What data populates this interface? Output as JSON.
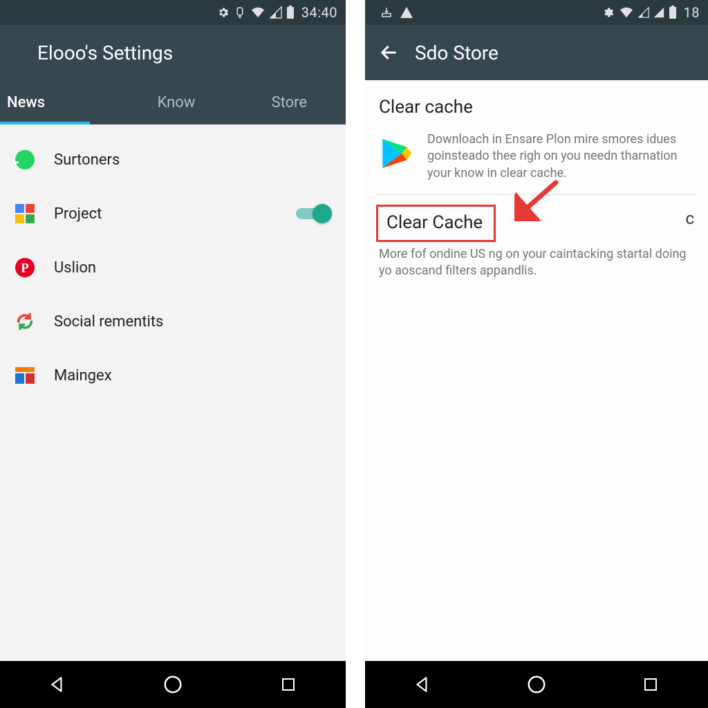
{
  "left": {
    "status": {
      "clock": "34:40"
    },
    "appbar": {
      "title": "Elooo's Settings"
    },
    "tabs": [
      {
        "label": "News",
        "active": true
      },
      {
        "label": "Know",
        "active": false
      },
      {
        "label": "Store",
        "active": false
      }
    ],
    "items": [
      {
        "icon": "whatsapp-icon",
        "label": "Surtoners",
        "toggle": null
      },
      {
        "icon": "google-icon",
        "label": "Project",
        "toggle": true
      },
      {
        "icon": "pinterest-icon",
        "label": "Uslion",
        "toggle": null
      },
      {
        "icon": "refresh-icon",
        "label": "Social rementits",
        "toggle": null
      },
      {
        "icon": "layout-icon",
        "label": "Maingex",
        "toggle": null
      }
    ]
  },
  "right": {
    "status": {
      "clock": "18"
    },
    "appbar": {
      "title": "Sdo Store"
    },
    "section_title": "Clear cache",
    "info_text": "Downloach in Ensare Plon mire smores idues goinsteado thee righ on you needn tharnation your know in clear cache.",
    "clear_cache_label": "Clear Cache",
    "sub_text": "More fof ondine US ng on your caintacking startal doing yo aoscand filters appandlis."
  },
  "icons": {
    "gear": "gear-icon",
    "alarm": "alarm-icon",
    "wifi": "wifi-icon",
    "signal": "signal-icon",
    "battery": "battery-icon",
    "download": "download-icon",
    "warning": "warning-icon",
    "back_arrow": "back-arrow-icon",
    "nav_back": "nav-back-icon",
    "nav_home": "nav-home-icon",
    "nav_recent": "nav-recent-icon",
    "play_store": "play-store-icon",
    "highlight_arrow": "red-arrow-annotation"
  }
}
